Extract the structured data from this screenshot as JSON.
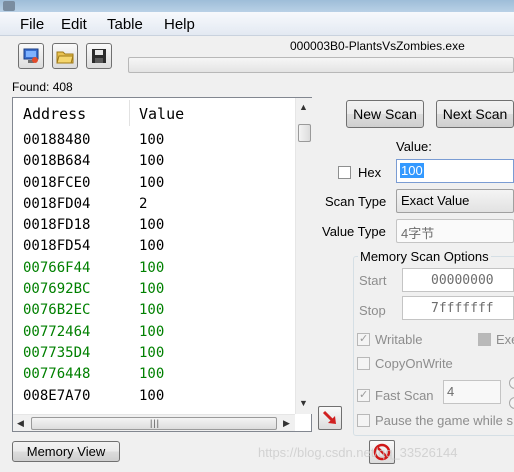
{
  "menu": {
    "items": [
      "File",
      "Edit",
      "Table",
      "Help"
    ]
  },
  "toolbar": {
    "icons": [
      "computer-process-icon",
      "open-folder-icon",
      "save-disk-icon"
    ]
  },
  "process": {
    "name": "000003B0-PlantsVsZombies.exe"
  },
  "results": {
    "found_label": "Found: 408",
    "columns": {
      "address": "Address",
      "value": "Value"
    },
    "rows": [
      {
        "address": "00188480",
        "value": "100",
        "color": "#000000"
      },
      {
        "address": "0018B684",
        "value": "100",
        "color": "#000000"
      },
      {
        "address": "0018FCE0",
        "value": "100",
        "color": "#000000"
      },
      {
        "address": "0018FD04",
        "value": "2",
        "color": "#000000"
      },
      {
        "address": "0018FD18",
        "value": "100",
        "color": "#000000"
      },
      {
        "address": "0018FD54",
        "value": "100",
        "color": "#000000"
      },
      {
        "address": "00766F44",
        "value": "100",
        "color": "#008000"
      },
      {
        "address": "007692BC",
        "value": "100",
        "color": "#008000"
      },
      {
        "address": "0076B2EC",
        "value": "100",
        "color": "#008000"
      },
      {
        "address": "00772464",
        "value": "100",
        "color": "#008000"
      },
      {
        "address": "007735D4",
        "value": "100",
        "color": "#008000"
      },
      {
        "address": "00776448",
        "value": "100",
        "color": "#008000"
      },
      {
        "address": "008E7A70",
        "value": "100",
        "color": "#000000"
      }
    ]
  },
  "scan": {
    "new_scan": "New Scan",
    "next_scan": "Next Scan",
    "value_label": "Value:",
    "hex_label": "Hex",
    "value": "100",
    "scan_type_label": "Scan Type",
    "scan_type": "Exact Value",
    "value_type_label": "Value Type",
    "value_type": "4字节"
  },
  "memory_options": {
    "title": "Memory Scan Options",
    "start_label": "Start",
    "start_value": "00000000",
    "stop_label": "Stop",
    "stop_value": "7fffffff",
    "writable_label": "Writable",
    "writable_checked": true,
    "executable_label": "Exe",
    "copyonwrite_label": "CopyOnWrite",
    "fastscan_label": "Fast Scan",
    "fastscan_value": "4",
    "pause_label": "Pause the game while s"
  },
  "bottom": {
    "memory_view": "Memory View"
  },
  "watermark": "https://blog.csdn.net/qq_33526144",
  "colors": {
    "found_green": "#008000",
    "selection_blue": "#3399ff"
  }
}
